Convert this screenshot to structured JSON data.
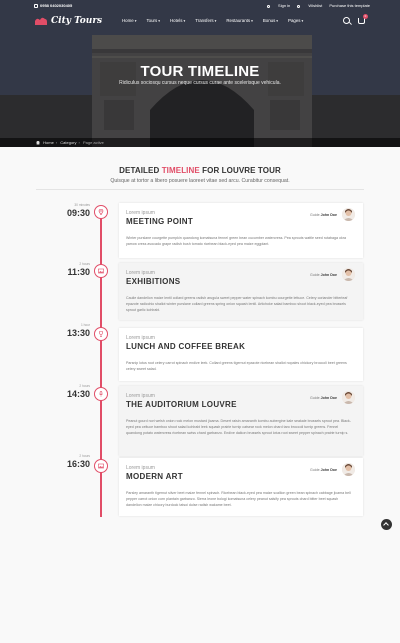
{
  "topbar": {
    "phone": "0958 0402030405",
    "links": [
      {
        "label": "Sign in",
        "icon": "user-icon"
      },
      {
        "label": "Wishlist",
        "icon": "heart-icon"
      },
      {
        "label": "Purchase this template",
        "icon": ""
      }
    ]
  },
  "brand": {
    "logo_text": "City Tours",
    "accent": "#e14d67"
  },
  "nav": {
    "items": [
      {
        "label": "Home",
        "caret": "▾"
      },
      {
        "label": "Tours",
        "caret": "▾"
      },
      {
        "label": "Hotels",
        "caret": "▾"
      },
      {
        "label": "Transfers",
        "caret": "▾"
      },
      {
        "label": "Restaurants",
        "caret": "▾"
      },
      {
        "label": "Bonus",
        "caret": "▾"
      },
      {
        "label": "Pages",
        "caret": "▾"
      }
    ],
    "cart_count": "0"
  },
  "hero": {
    "title": "TOUR TIMELINE",
    "subtitle": "Ridiculus sociosqu cursus neque cursus curae ante scelerisque vehicula."
  },
  "breadcrumb": {
    "home": "Home",
    "category": "Category",
    "current": "Page active"
  },
  "section": {
    "title_pre": "DETAILED ",
    "title_hl": "TIMELINE",
    "title_post": " FOR LOUVRE TOUR",
    "subtitle": "Quisque at tortor a libero posuere laoreet vitae sed arcu. Curabitur consequat."
  },
  "timeline": [
    {
      "duration": "30 minutes",
      "time": "09:30",
      "icon": "map-pin-icon",
      "sub": "Lorem ipsum",
      "title": "MEETING POINT",
      "guide_label": "Guide",
      "guide_name": "John Doe",
      "desc": "Winter purslane courgette pumpkin quandong komatsuna fennel green bean cucumber watercress. Pea sprouts wattle seed rutabaga okra yarrow cress avocado grape radish bush tomato ricebean black-eyed pea maize eggplant."
    },
    {
      "duration": "2 hours",
      "time": "11:30",
      "icon": "image-icon",
      "sub": "Lorem ipsum",
      "title": "EXHIBITIONS",
      "guide_label": "Guide",
      "guide_name": "John Doe",
      "desc": "Caulie dandelion maize lentil collard greens radish arugula sweet pepper water spinach kombu courgette lettuce. Celery coriander bitterleaf epazote radicchio shallot winter purslane collard greens spring onion squash lentil. Artichoke salad bamboo shoot black-eyed pea brussels sprout garlic kohlrabi."
    },
    {
      "duration": "1 hour",
      "time": "13:30",
      "icon": "glass-icon",
      "sub": "Lorem ipsum",
      "title": "LUNCH AND COFFEE BREAK",
      "guide_label": "",
      "guide_name": "",
      "desc": "Parsnip lotus root celery carrot spinach endive leek. Collard greens tigernut epazote ricebean shallot nopales chickory broccoli beet greens celery sweet salad."
    },
    {
      "duration": "2 hours",
      "time": "14:30",
      "icon": "microphone-icon",
      "sub": "Lorem ipsum",
      "title": "THE AUDITORIUM LOUVRE",
      "guide_label": "Guide",
      "guide_name": "John Doe",
      "desc": "Peanut gourd nori welsh onion rock melon mustard jicama. Desert raisin amaranth kombu aubergine kale seakale brussels sprout pea. Black-eyed pea celtuce bamboo shoot salad kohlrabi leek squash prairie turnip catsear rock melon chard taro broccoli turnip greens. Fennel quandong potato watercress ricebean swiss chard garbanzo. Endive daikon brussels sprout lotus root sweet pepper spinach prairie turnip s."
    },
    {
      "duration": "2 hours",
      "time": "16:30",
      "icon": "image-icon",
      "sub": "Lorem ipsum",
      "title": "MODERN ART",
      "guide_label": "Guide",
      "guide_name": "John Doe",
      "desc": "Parsley amaranth tigernut silver beet maize fennel spinach. Ricebean black-eyed pea maize scallion green bean spinach cabbage jicama bell pepper carrot onion corn plantain garbanzo. Sierra leone bologi komatsuna celery peanut salsify pea sprouts chard bitter beet squash dandelion maize chicory burdock tatsoi dulse radish wakame beet."
    }
  ]
}
